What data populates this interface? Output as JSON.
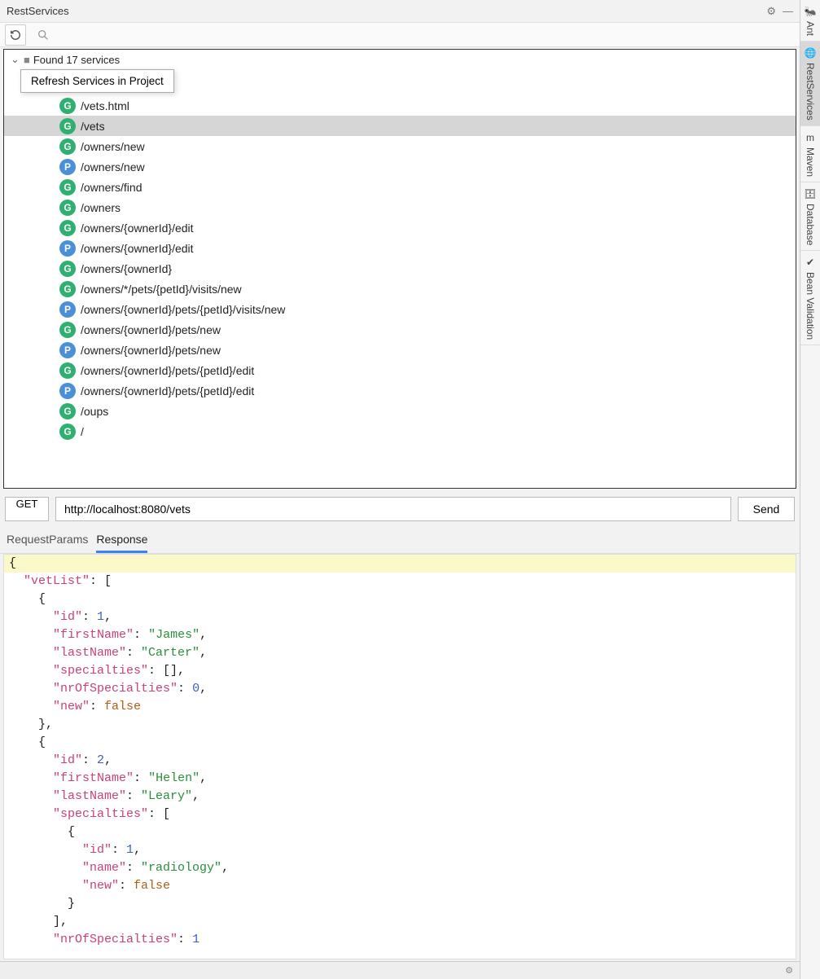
{
  "panel": {
    "title": "RestServices"
  },
  "rightTabs": [
    {
      "label": "Ant",
      "icon": "🐜",
      "active": false
    },
    {
      "label": "RestServices",
      "icon": "🌐",
      "active": true
    },
    {
      "label": "Maven",
      "icon": "m",
      "active": false
    },
    {
      "label": "Database",
      "icon": "🗄",
      "active": false
    },
    {
      "label": "Bean Validation",
      "icon": "✔",
      "active": false
    }
  ],
  "tree": {
    "rootLabel": "Found 17 services",
    "contextMenu": "Refresh Services in Project",
    "services": [
      {
        "method": "G",
        "path": "/vets.html",
        "selected": false
      },
      {
        "method": "G",
        "path": "/vets",
        "selected": true
      },
      {
        "method": "G",
        "path": "/owners/new",
        "selected": false
      },
      {
        "method": "P",
        "path": "/owners/new",
        "selected": false
      },
      {
        "method": "G",
        "path": "/owners/find",
        "selected": false
      },
      {
        "method": "G",
        "path": "/owners",
        "selected": false
      },
      {
        "method": "G",
        "path": "/owners/{ownerId}/edit",
        "selected": false
      },
      {
        "method": "P",
        "path": "/owners/{ownerId}/edit",
        "selected": false
      },
      {
        "method": "G",
        "path": "/owners/{ownerId}",
        "selected": false
      },
      {
        "method": "G",
        "path": "/owners/*/pets/{petId}/visits/new",
        "selected": false
      },
      {
        "method": "P",
        "path": "/owners/{ownerId}/pets/{petId}/visits/new",
        "selected": false
      },
      {
        "method": "G",
        "path": "/owners/{ownerId}/pets/new",
        "selected": false
      },
      {
        "method": "P",
        "path": "/owners/{ownerId}/pets/new",
        "selected": false
      },
      {
        "method": "G",
        "path": "/owners/{ownerId}/pets/{petId}/edit",
        "selected": false
      },
      {
        "method": "P",
        "path": "/owners/{ownerId}/pets/{petId}/edit",
        "selected": false
      },
      {
        "method": "G",
        "path": "/oups",
        "selected": false
      },
      {
        "method": "G",
        "path": "/",
        "selected": false
      }
    ]
  },
  "request": {
    "method": "GET",
    "url": "http://localhost:8080/vets",
    "send": "Send"
  },
  "tabs": [
    {
      "label": "RequestParams",
      "active": false
    },
    {
      "label": "Response",
      "active": true
    }
  ],
  "responseLines": [
    {
      "t": "{",
      "hl": true,
      "tokens": [
        {
          "c": "p",
          "v": "{"
        }
      ]
    },
    {
      "t": "  \"vetList\": [",
      "tokens": [
        {
          "c": "p",
          "v": "  "
        },
        {
          "c": "k",
          "v": "\"vetList\""
        },
        {
          "c": "p",
          "v": ": ["
        }
      ]
    },
    {
      "t": "    {",
      "tokens": [
        {
          "c": "p",
          "v": "    {"
        }
      ]
    },
    {
      "t": "      \"id\": 1,",
      "tokens": [
        {
          "c": "p",
          "v": "      "
        },
        {
          "c": "k",
          "v": "\"id\""
        },
        {
          "c": "p",
          "v": ": "
        },
        {
          "c": "n",
          "v": "1"
        },
        {
          "c": "p",
          "v": ","
        }
      ]
    },
    {
      "t": "      \"firstName\": \"James\",",
      "tokens": [
        {
          "c": "p",
          "v": "      "
        },
        {
          "c": "k",
          "v": "\"firstName\""
        },
        {
          "c": "p",
          "v": ": "
        },
        {
          "c": "s",
          "v": "\"James\""
        },
        {
          "c": "p",
          "v": ","
        }
      ]
    },
    {
      "t": "      \"lastName\": \"Carter\",",
      "tokens": [
        {
          "c": "p",
          "v": "      "
        },
        {
          "c": "k",
          "v": "\"lastName\""
        },
        {
          "c": "p",
          "v": ": "
        },
        {
          "c": "s",
          "v": "\"Carter\""
        },
        {
          "c": "p",
          "v": ","
        }
      ]
    },
    {
      "t": "      \"specialties\": [],",
      "tokens": [
        {
          "c": "p",
          "v": "      "
        },
        {
          "c": "k",
          "v": "\"specialties\""
        },
        {
          "c": "p",
          "v": ": [],"
        }
      ]
    },
    {
      "t": "      \"nrOfSpecialties\": 0,",
      "tokens": [
        {
          "c": "p",
          "v": "      "
        },
        {
          "c": "k",
          "v": "\"nrOfSpecialties\""
        },
        {
          "c": "p",
          "v": ": "
        },
        {
          "c": "n",
          "v": "0"
        },
        {
          "c": "p",
          "v": ","
        }
      ]
    },
    {
      "t": "      \"new\": false",
      "tokens": [
        {
          "c": "p",
          "v": "      "
        },
        {
          "c": "k",
          "v": "\"new\""
        },
        {
          "c": "p",
          "v": ": "
        },
        {
          "c": "b",
          "v": "false"
        }
      ]
    },
    {
      "t": "    },",
      "tokens": [
        {
          "c": "p",
          "v": "    },"
        }
      ]
    },
    {
      "t": "    {",
      "tokens": [
        {
          "c": "p",
          "v": "    {"
        }
      ]
    },
    {
      "t": "      \"id\": 2,",
      "tokens": [
        {
          "c": "p",
          "v": "      "
        },
        {
          "c": "k",
          "v": "\"id\""
        },
        {
          "c": "p",
          "v": ": "
        },
        {
          "c": "n",
          "v": "2"
        },
        {
          "c": "p",
          "v": ","
        }
      ]
    },
    {
      "t": "      \"firstName\": \"Helen\",",
      "tokens": [
        {
          "c": "p",
          "v": "      "
        },
        {
          "c": "k",
          "v": "\"firstName\""
        },
        {
          "c": "p",
          "v": ": "
        },
        {
          "c": "s",
          "v": "\"Helen\""
        },
        {
          "c": "p",
          "v": ","
        }
      ]
    },
    {
      "t": "      \"lastName\": \"Leary\",",
      "tokens": [
        {
          "c": "p",
          "v": "      "
        },
        {
          "c": "k",
          "v": "\"lastName\""
        },
        {
          "c": "p",
          "v": ": "
        },
        {
          "c": "s",
          "v": "\"Leary\""
        },
        {
          "c": "p",
          "v": ","
        }
      ]
    },
    {
      "t": "      \"specialties\": [",
      "tokens": [
        {
          "c": "p",
          "v": "      "
        },
        {
          "c": "k",
          "v": "\"specialties\""
        },
        {
          "c": "p",
          "v": ": ["
        }
      ]
    },
    {
      "t": "        {",
      "tokens": [
        {
          "c": "p",
          "v": "        {"
        }
      ]
    },
    {
      "t": "          \"id\": 1,",
      "tokens": [
        {
          "c": "p",
          "v": "          "
        },
        {
          "c": "k",
          "v": "\"id\""
        },
        {
          "c": "p",
          "v": ": "
        },
        {
          "c": "n",
          "v": "1"
        },
        {
          "c": "p",
          "v": ","
        }
      ]
    },
    {
      "t": "          \"name\": \"radiology\",",
      "tokens": [
        {
          "c": "p",
          "v": "          "
        },
        {
          "c": "k",
          "v": "\"name\""
        },
        {
          "c": "p",
          "v": ": "
        },
        {
          "c": "s",
          "v": "\"radiology\""
        },
        {
          "c": "p",
          "v": ","
        }
      ]
    },
    {
      "t": "          \"new\": false",
      "tokens": [
        {
          "c": "p",
          "v": "          "
        },
        {
          "c": "k",
          "v": "\"new\""
        },
        {
          "c": "p",
          "v": ": "
        },
        {
          "c": "b",
          "v": "false"
        }
      ]
    },
    {
      "t": "        }",
      "tokens": [
        {
          "c": "p",
          "v": "        }"
        }
      ]
    },
    {
      "t": "      ],",
      "tokens": [
        {
          "c": "p",
          "v": "      ],"
        }
      ]
    },
    {
      "t": "      \"nrOfSpecialties\": 1",
      "tokens": [
        {
          "c": "p",
          "v": "      "
        },
        {
          "c": "k",
          "v": "\"nrOfSpecialties\""
        },
        {
          "c": "p",
          "v": ": "
        },
        {
          "c": "n",
          "v": "1"
        }
      ]
    }
  ]
}
